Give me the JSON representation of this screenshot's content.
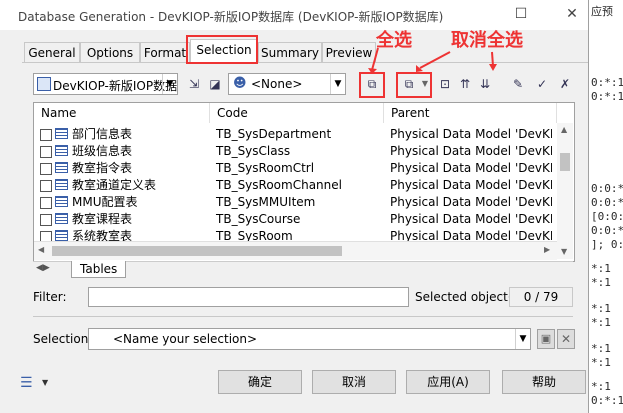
{
  "window": {
    "title": "Database Generation - DevKIOP-新版IOP数据库 (DevKIOP-新版IOP数据库)",
    "maximize_glyph": "☐",
    "close_glyph": "✕"
  },
  "tabs": [
    "General",
    "Options",
    "Format",
    "Selection",
    "Summary",
    "Preview"
  ],
  "active_tab": "Selection",
  "annotations": {
    "select_all": "全选",
    "deselect_all": "取消全选"
  },
  "toolbar": {
    "model_combo": "DevKIOP-新版IOP数据",
    "owner_combo": "<None>"
  },
  "table": {
    "headers": [
      "Name",
      "Code",
      "Parent"
    ],
    "rows": [
      {
        "name": "部门信息表",
        "code": "TB_SysDepartment",
        "parent": "Physical Data Model 'DevKIOP-..."
      },
      {
        "name": "班级信息表",
        "code": "TB_SysClass",
        "parent": "Physical Data Model 'DevKIOP-..."
      },
      {
        "name": "教室指令表",
        "code": "TB_SysRoomCtrl",
        "parent": "Physical Data Model 'DevKIOP-..."
      },
      {
        "name": "教室通道定义表",
        "code": "TB_SysRoomChannel",
        "parent": "Physical Data Model 'DevKIOP-..."
      },
      {
        "name": "MMU配置表",
        "code": "TB_SysMMUItem",
        "parent": "Physical Data Model 'DevKIOP-..."
      },
      {
        "name": "教室课程表",
        "code": "TB_SysCourse",
        "parent": "Physical Data Model 'DevKIOP-..."
      },
      {
        "name": "系统教室表",
        "code": "TB_SysRoom",
        "parent": "Physical Data Model 'DevKIOP-..."
      }
    ]
  },
  "subtab": "Tables",
  "filter": {
    "label": "Filter:",
    "value": ""
  },
  "selected": {
    "label": "Selected object(s):",
    "value": "0 / 79"
  },
  "selection": {
    "label": "Selection:",
    "value": "<Name your selection>"
  },
  "buttons": {
    "ok": "确定",
    "cancel": "取消",
    "apply": "应用(A)",
    "help": "帮助"
  },
  "background_text": [
    "应预",
    "0:*:1",
    "0:*:1",
    "0:0:*",
    "0:0:*",
    "[0:0:",
    "0:0:*",
    "]; 0:",
    "*:1",
    "*:1",
    "*:1",
    "*:1",
    "*:1",
    "*:1",
    "*:1",
    "0:*:1"
  ]
}
